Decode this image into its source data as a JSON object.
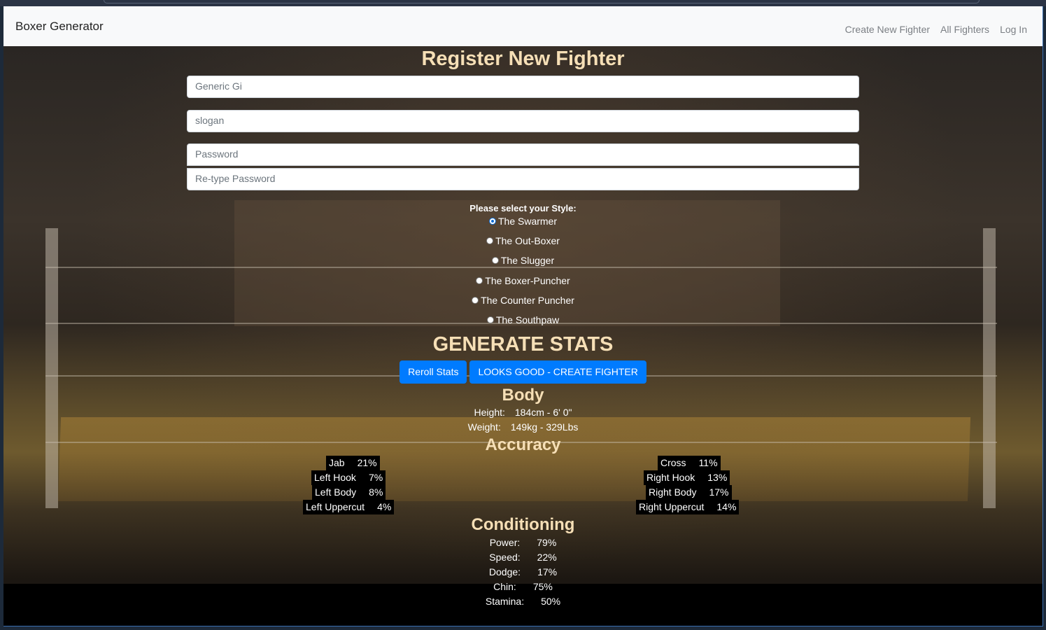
{
  "navbar": {
    "brand": "Boxer Generator",
    "links": [
      "Create New Fighter",
      "All Fighters",
      "Log In"
    ]
  },
  "page_title": "Register New Fighter",
  "form": {
    "name_value": "Generic Gi",
    "slogan_value": "slogan",
    "password_placeholder": "Password",
    "retype_placeholder": "Re-type Password"
  },
  "style": {
    "label": "Please select your Style:",
    "options": [
      "The Swarmer",
      "The Out-Boxer",
      "The Slugger",
      "The Boxer-Puncher",
      "The Counter Puncher",
      "The Southpaw"
    ],
    "selected": "The Swarmer"
  },
  "generate_title": "GENERATE STATS",
  "buttons": {
    "reroll": "Reroll Stats",
    "create": "LOOKS GOOD - CREATE FIGHTER"
  },
  "body": {
    "title": "Body",
    "height_label": "Height:",
    "height_value": "184cm - 6' 0\"",
    "weight_label": "Weight:",
    "weight_value": "149kg - 329Lbs"
  },
  "accuracy": {
    "title": "Accuracy",
    "left": [
      {
        "label": "Jab",
        "value": "21%"
      },
      {
        "label": "Left Hook",
        "value": "7%"
      },
      {
        "label": "Left Body",
        "value": "8%"
      },
      {
        "label": "Left Uppercut",
        "value": "4%"
      }
    ],
    "right": [
      {
        "label": "Cross",
        "value": "11%"
      },
      {
        "label": "Right Hook",
        "value": "13%"
      },
      {
        "label": "Right Body",
        "value": "17%"
      },
      {
        "label": "Right Uppercut",
        "value": "14%"
      }
    ]
  },
  "conditioning": {
    "title": "Conditioning",
    "stats": [
      {
        "label": "Power:",
        "value": "79%"
      },
      {
        "label": "Speed:",
        "value": "22%"
      },
      {
        "label": "Dodge:",
        "value": "17%"
      },
      {
        "label": "Chin:",
        "value": "75%"
      },
      {
        "label": "Stamina:",
        "value": "50%"
      }
    ]
  },
  "colors": {
    "accent": "#007bff",
    "title": "#f6dfb6",
    "navbar_bg": "#f8f9fa"
  }
}
